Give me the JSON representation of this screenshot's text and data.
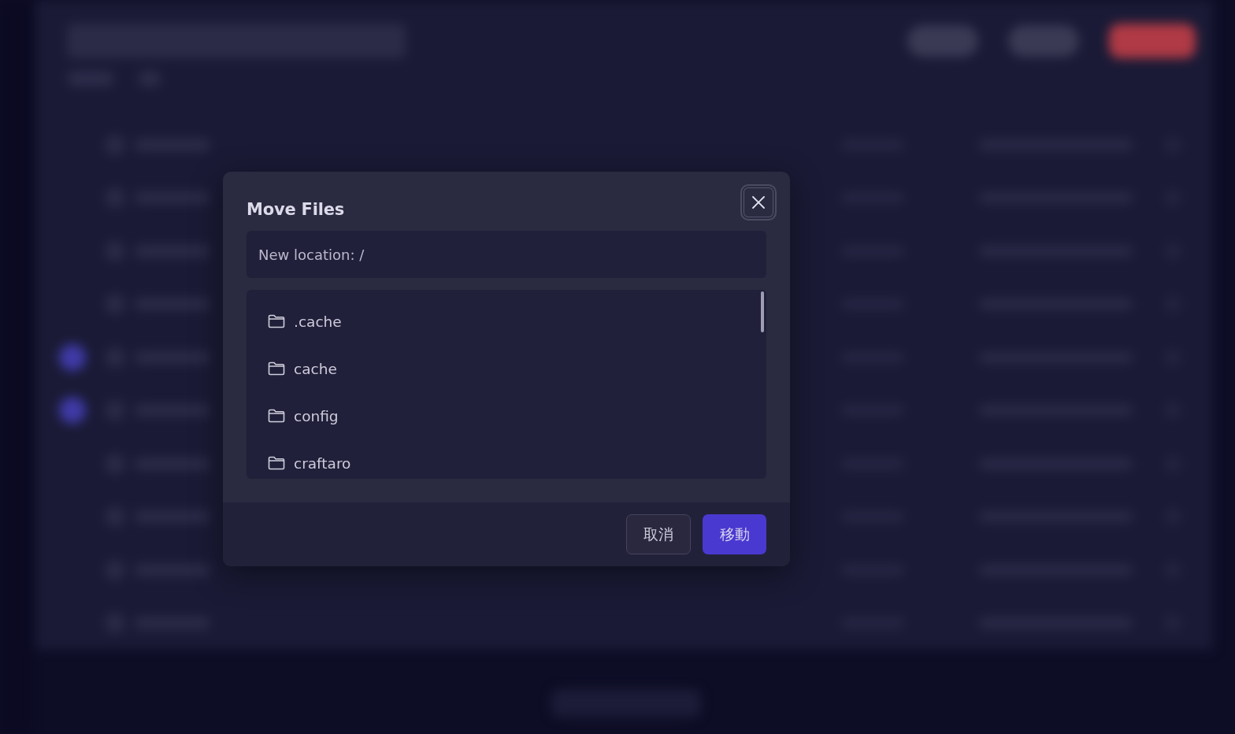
{
  "dialog": {
    "title": "Move Files",
    "location_field": {
      "value": "New location: /"
    },
    "folders": [
      {
        "name": ".cache"
      },
      {
        "name": "cache"
      },
      {
        "name": "config"
      },
      {
        "name": "craftaro"
      }
    ],
    "buttons": [
      {
        "label": "取消",
        "kind": "secondary"
      },
      {
        "label": "移動",
        "kind": "primary"
      }
    ]
  }
}
